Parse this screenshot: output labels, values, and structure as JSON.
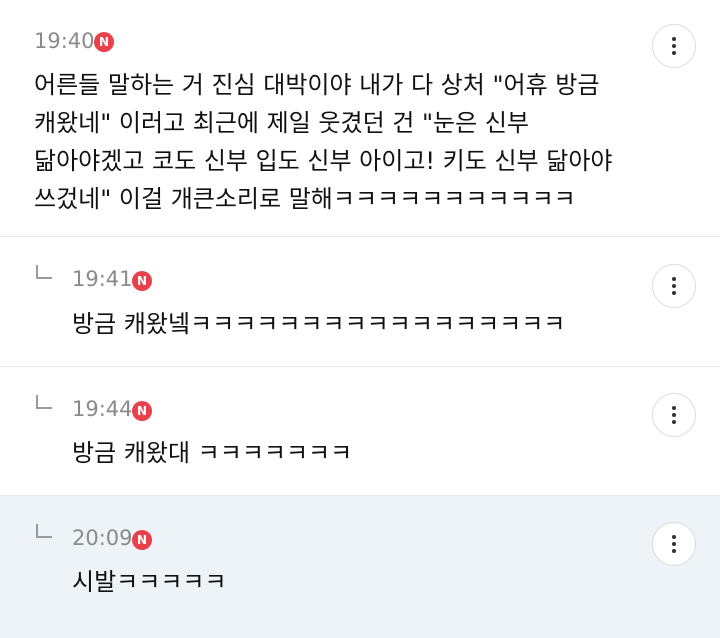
{
  "comments": [
    {
      "time": "19:40",
      "badge": "N",
      "text": "어른들 말하는 거 진심 대박이야 내가 다 상처 \"어휴 방금\n캐왔네\" 이러고 최근에 제일 웃겼던 건 \"눈은 신부\n닮아야겠고 코도 신부 입도 신부 아이고! 키도 신부 닮아야\n쓰겄네\" 이걸 개큰소리로 말해ㅋㅋㅋㅋㅋㅋㅋㅋㅋㅋㅋ"
    },
    {
      "time": "19:41",
      "badge": "N",
      "text": "방금 캐왔넼ㅋㅋㅋㅋㅋㅋㅋㅋㅋㅋㅋㅋㅋㅋㅋㅋㅋ"
    },
    {
      "time": "19:44",
      "badge": "N",
      "text": "방금 캐왔대 ㅋㅋㅋㅋㅋㅋㅋ"
    },
    {
      "time": "20:09",
      "badge": "N",
      "text": "시발ㅋㅋㅋㅋㅋ"
    }
  ]
}
